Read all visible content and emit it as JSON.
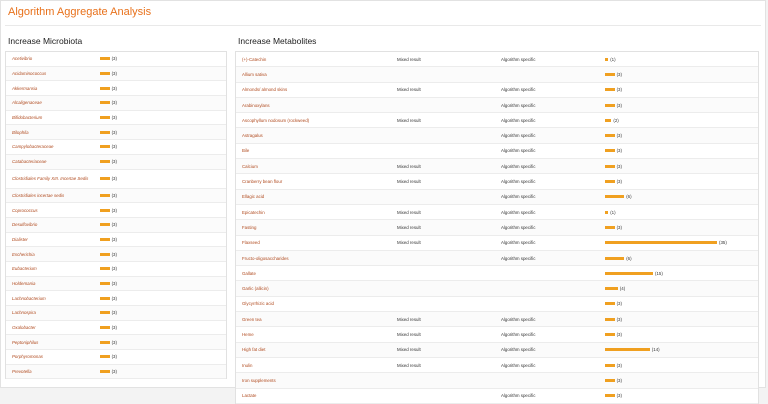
{
  "page_title": "Algorithm Aggregate Analysis",
  "microbiota": {
    "title": "Increase Microbiota",
    "rows": [
      {
        "name": "Acetivibrio",
        "count": 3
      },
      {
        "name": "Acidaminococcus",
        "count": 3
      },
      {
        "name": "Akkermansia",
        "count": 3
      },
      {
        "name": "Alcaligenaceae",
        "count": 3
      },
      {
        "name": "Bifidobacterium",
        "count": 3
      },
      {
        "name": "Bilophila",
        "count": 3
      },
      {
        "name": "Campylobacteraceae",
        "count": 3
      },
      {
        "name": "Catabacteriaceae",
        "count": 3
      },
      {
        "name": "Clostridiales Family XIII. Incertae Sedis",
        "count": 3
      },
      {
        "name": "Clostridiales incertae sedis",
        "count": 3
      },
      {
        "name": "Coprococcus",
        "count": 3
      },
      {
        "name": "Desulfovibrio",
        "count": 3
      },
      {
        "name": "Dialister",
        "count": 3
      },
      {
        "name": "Escherichia",
        "count": 3
      },
      {
        "name": "Eubacterium",
        "count": 3
      },
      {
        "name": "Holdemania",
        "count": 3
      },
      {
        "name": "Lachnobacterium",
        "count": 3
      },
      {
        "name": "Lachnospira",
        "count": 3
      },
      {
        "name": "Oxalobacter",
        "count": 3
      },
      {
        "name": "Peptoniphilus",
        "count": 3
      },
      {
        "name": "Porphyromonas",
        "count": 3
      },
      {
        "name": "Prevotella",
        "count": 3
      }
    ]
  },
  "metabolites": {
    "title": "Increase Metabolites",
    "rows": [
      {
        "name": "(+)-Catechin",
        "mixed": "Mixed result",
        "specific": "Algorithm specific",
        "count": 1
      },
      {
        "name": "Allium sativa",
        "mixed": "",
        "specific": "",
        "count": 3
      },
      {
        "name": "Almonds/ almond skins",
        "mixed": "Mixed result",
        "specific": "Algorithm specific",
        "count": 3
      },
      {
        "name": "Arabinoxylans",
        "mixed": "",
        "specific": "Algorithm specific",
        "count": 3
      },
      {
        "name": "Ascophyllum nodosum (rockweed)",
        "mixed": "Mixed result",
        "specific": "Algorithm specific",
        "count": 2
      },
      {
        "name": "Astragalus",
        "mixed": "",
        "specific": "Algorithm specific",
        "count": 3
      },
      {
        "name": "Bile",
        "mixed": "",
        "specific": "Algorithm specific",
        "count": 3
      },
      {
        "name": "Calcium",
        "mixed": "Mixed result",
        "specific": "Algorithm specific",
        "count": 3
      },
      {
        "name": "Cranberry bean flour",
        "mixed": "Mixed result",
        "specific": "Algorithm specific",
        "count": 3
      },
      {
        "name": "Ellagic acid",
        "mixed": "",
        "specific": "Algorithm specific",
        "count": 6
      },
      {
        "name": "Epicatechin",
        "mixed": "Mixed result",
        "specific": "Algorithm specific",
        "count": 1
      },
      {
        "name": "Fasting",
        "mixed": "Mixed result",
        "specific": "Algorithm specific",
        "count": 3
      },
      {
        "name": "Flaxseed",
        "mixed": "Mixed result",
        "specific": "Algorithm specific",
        "count": 35
      },
      {
        "name": "Fructo-oligosaccharides",
        "mixed": "",
        "specific": "Algorithm specific",
        "count": 6
      },
      {
        "name": "Gallate",
        "mixed": "",
        "specific": "",
        "count": 15
      },
      {
        "name": "Garlic (allicin)",
        "mixed": "",
        "specific": "",
        "count": 4
      },
      {
        "name": "Glycyrrhizic acid",
        "mixed": "",
        "specific": "",
        "count": 3
      },
      {
        "name": "Green tea",
        "mixed": "Mixed result",
        "specific": "Algorithm specific",
        "count": 3
      },
      {
        "name": "Heme",
        "mixed": "Mixed result",
        "specific": "Algorithm specific",
        "count": 3
      },
      {
        "name": "High fat diet",
        "mixed": "Mixed result",
        "specific": "Algorithm specific",
        "count": 14
      },
      {
        "name": "Inulin",
        "mixed": "Mixed result",
        "specific": "Algorithm specific",
        "count": 3
      },
      {
        "name": "Iron supplements",
        "mixed": "",
        "specific": "",
        "count": 3
      },
      {
        "name": "Lactate",
        "mixed": "",
        "specific": "Algorithm specific",
        "count": 3
      }
    ]
  }
}
